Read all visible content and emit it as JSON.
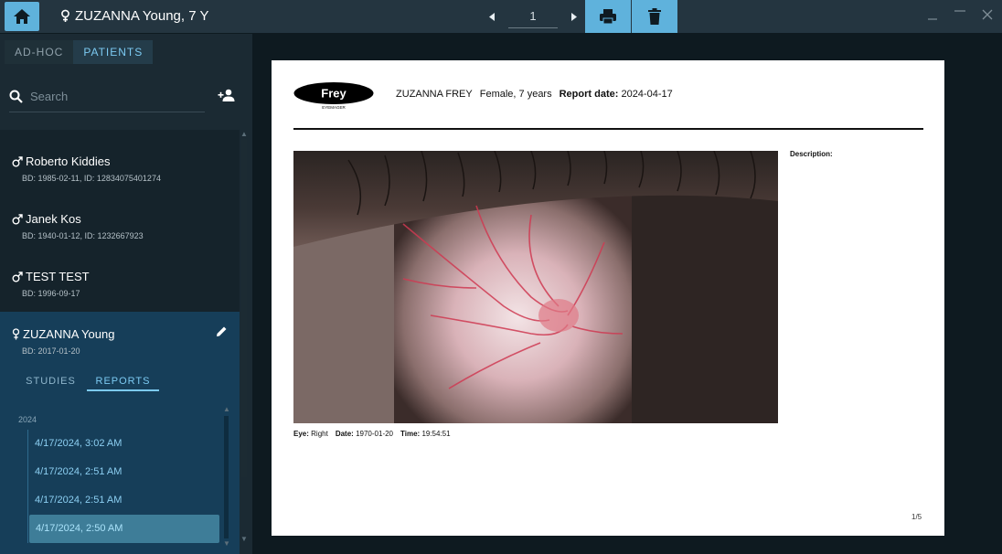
{
  "titlebar": {
    "title": "ZUZANNA Young, 7 Y",
    "page_number": "1"
  },
  "sidebar": {
    "tabs": [
      "AD-HOC",
      "PATIENTS"
    ],
    "search_placeholder": "Search",
    "patients": [
      {
        "name": "Roberto Kiddies",
        "info": "BD: 1985-02-11, ID: 12834075401274"
      },
      {
        "name": "Janek Kos",
        "info": "BD: 1940-01-12, ID: 1232667923"
      },
      {
        "name": "TEST TEST",
        "info": "BD: 1996-09-17"
      },
      {
        "name": "ZUZANNA Young",
        "info": "BD: 2017-01-20"
      }
    ],
    "subtabs": [
      "STUDIES",
      "REPORTS"
    ],
    "year": "2024",
    "reports": [
      "4/17/2024, 3:02 AM",
      "4/17/2024, 2:51 AM",
      "4/17/2024, 2:51 AM",
      "4/17/2024, 2:50 AM"
    ]
  },
  "document": {
    "logo": "Frey",
    "logo_sub": "EYEMAGER",
    "patient_name": "ZUZANNA FREY",
    "patient_meta": "Female, 7 years",
    "report_date_label": "Report date:",
    "report_date": "2024-04-17",
    "description_label": "Description:",
    "eye_label": "Eye:",
    "eye_value": "Right",
    "date_label": "Date:",
    "date_value": "1970-01-20",
    "time_label": "Time:",
    "time_value": "19:54:51",
    "page_indicator": "1/5"
  },
  "colors": {
    "accent": "#5fb2dc",
    "selected_patient_bg": "#163e59",
    "selected_report_bg": "#3e7d98"
  }
}
